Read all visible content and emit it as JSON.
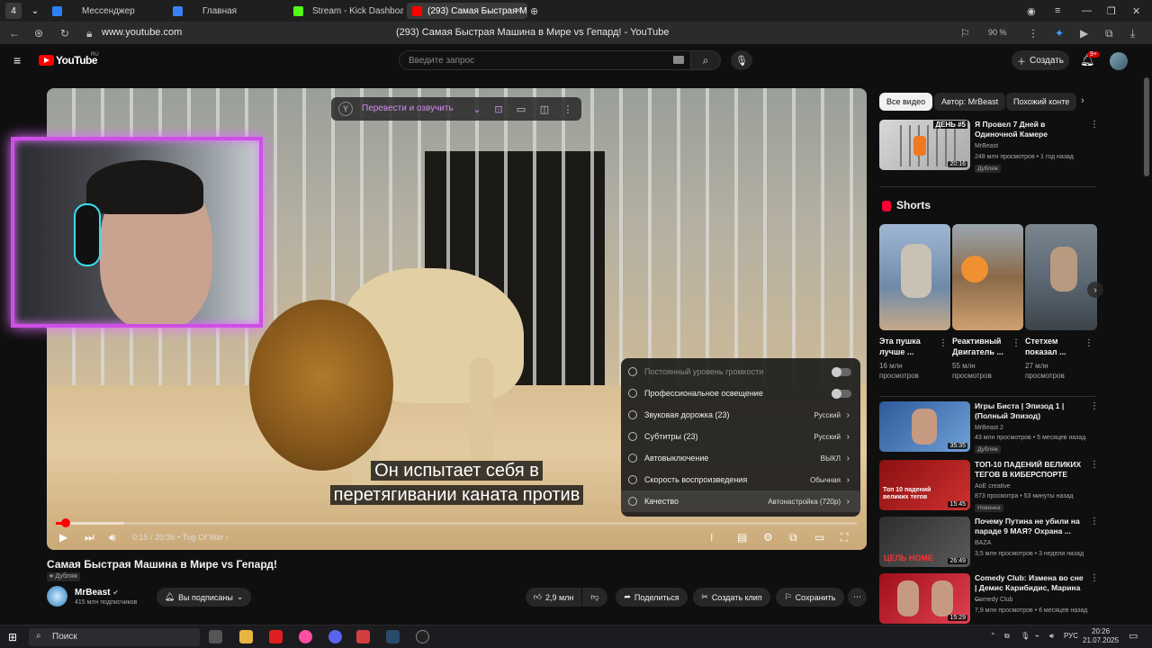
{
  "browser": {
    "tab_count_badge": "4",
    "tabs": [
      {
        "label": "Мессенджер",
        "color": "#2d7ff9"
      },
      {
        "label": "Главная",
        "color": "#3b82f6"
      },
      {
        "label": "Stream - Kick Dashboard",
        "color": "#53fc18"
      },
      {
        "label": "(293) Самая Быстрая М",
        "color": "#ff0000"
      }
    ],
    "url": "www.youtube.com",
    "page_title": "(293) Самая Быстрая Машина в Мире vs Гепард! - YouTube",
    "zoom": "90 %"
  },
  "youtube": {
    "logo": "YouTube",
    "region": "RU",
    "search_placeholder": "Введите запрос",
    "create_label": "Создать",
    "notifications_badge": "9+"
  },
  "player": {
    "translate_label": "Перевести и озвучить",
    "subtitle_line1": "Он испытает себя в",
    "subtitle_line2": "перетягивании каната против",
    "time": "0:15 / 20:36",
    "chapter": "• Tug Of War",
    "progress_played": 0.012,
    "progress_loaded": 0.085,
    "settings": [
      {
        "label": "Постоянный уровень громкости",
        "value": "",
        "toggle": true,
        "dim": true
      },
      {
        "label": "Профессиональное освещение",
        "value": "",
        "toggle": true,
        "dim": false
      },
      {
        "label": "Звуковая дорожка (23)",
        "value": "Русский",
        "toggle": false,
        "dim": false
      },
      {
        "label": "Субтитры (23)",
        "value": "Русский",
        "toggle": false,
        "dim": false
      },
      {
        "label": "Автовыключение",
        "value": "ВЫКЛ",
        "toggle": false,
        "dim": false
      },
      {
        "label": "Скорость воспроизведения",
        "value": "Обычная",
        "toggle": false,
        "dim": false
      },
      {
        "label": "Качество",
        "value": "Автонастройка (720p)",
        "toggle": false,
        "dim": false
      }
    ]
  },
  "video": {
    "title": "Самая Быстрая Машина в Мире vs Гепард!",
    "dub_badge": "Дубляж",
    "channel": "MrBeast",
    "subscribers": "415 млн подписчиков",
    "subscribed_label": "Вы подписаны",
    "likes": "2,9 млн",
    "share_label": "Поделиться",
    "clip_label": "Создать клип",
    "save_label": "Сохранить"
  },
  "sidebar": {
    "chips": [
      "Все видео",
      "Автор: MrBeast",
      "Похожий конте"
    ],
    "top_rec": {
      "title": "Я Провел 7 Дней в Одиночной Камере",
      "channel": "MrBeast",
      "meta": "248 млн просмотров • 1 год назад",
      "badge": "Дубляж",
      "duration": "20:16",
      "thumb_text": "ДЕНЬ #5"
    },
    "shorts_title": "Shorts",
    "shorts": [
      {
        "title": "Эта пушка лучше ...",
        "views": "16 млн просмотров",
        "color": "#6f8aa8"
      },
      {
        "title": "Реактивный Двигатель ...",
        "views": "55 млн просмотров",
        "color": "#8a6a4a"
      },
      {
        "title": "Стетхем показал ...",
        "views": "27 млн просмотров",
        "color": "#5a6672"
      }
    ],
    "recs": [
      {
        "title": "Игры Биста | Эпизод 1 | (Полный Эпизод)",
        "channel": "MrBeast 2",
        "meta": "43 млн просмотров • 5 месяцев назад",
        "badge": "Дубляж",
        "duration": "35:35",
        "color": "#3a6fb0"
      },
      {
        "title": "ТОП-10 ПАДЕНИЙ ВЕЛИКИХ ТЕГОВ В КИБЕРСПОРТЕ",
        "channel": "AoE creative",
        "meta": "873 просмотра • 53 минуты назад",
        "badge": "Новинка",
        "duration": "15:45",
        "color": "#b01c1c",
        "thumb_text": "Топ 10 падений великих тегов"
      },
      {
        "title": "Почему Путина не убили на параде 9 МАЯ? Охрана ...",
        "channel": "BAZA",
        "meta": "3,5 млн просмотров • 3 недели назад",
        "badge": "",
        "duration": "26:49",
        "color": "#4a4a4a",
        "thumb_text": "ЦЕЛЬ НОМЕ"
      },
      {
        "title": "Comedy Club: Измена во сне | Демис Карибидис, Марина ...",
        "channel": "Comedy Club",
        "meta": "7,9 млн просмотров • 6 месяцев назад",
        "badge": "",
        "duration": "15:29",
        "color": "#c0202a"
      }
    ]
  },
  "taskbar": {
    "search_label": "Поиск",
    "lang": "РУС",
    "time": "20:26",
    "date": "21.07.2025"
  }
}
